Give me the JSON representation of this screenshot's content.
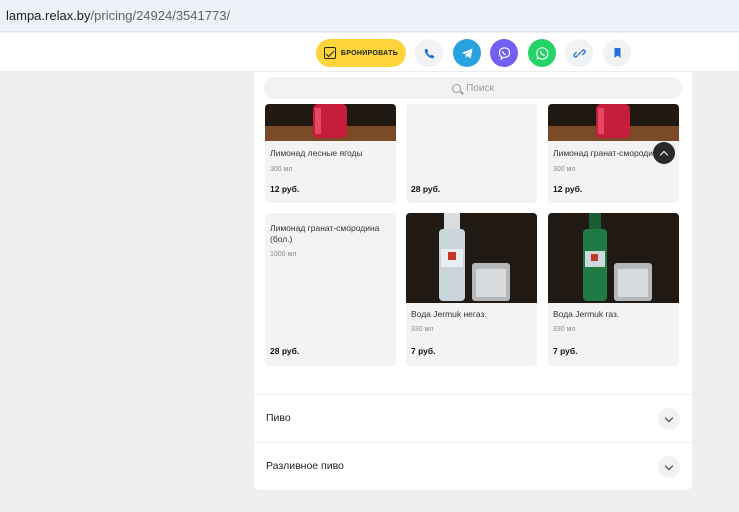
{
  "browser": {
    "url_host": "lampa.relax.by",
    "url_path": "/pricing/24924/3541773/"
  },
  "topbar": {
    "book_label": "БРОНИРОВАТЬ",
    "icons": [
      "calendar-icon",
      "phone-icon",
      "telegram-icon",
      "viber-icon",
      "whatsapp-icon",
      "link-icon",
      "bookmark-icon"
    ],
    "colors": {
      "book": "#ffd43b",
      "telegram": "#29a3e0",
      "viber": "#7360f2",
      "whatsapp": "#25d366"
    }
  },
  "search": {
    "placeholder": "Поиск"
  },
  "products": [
    {
      "name": "Лимонад лесные ягоды",
      "volume": "300 мл",
      "price": "12 руб."
    },
    {
      "name": "",
      "volume": "",
      "price": "28 руб."
    },
    {
      "name": "Лимонад гранат-смородина",
      "volume": "300 мл",
      "price": "12 руб."
    },
    {
      "name": "Лимонад гранат-смородина (бол.)",
      "volume": "1000 мл",
      "price": "28 руб."
    },
    {
      "name": "Вода Jermuk негаз.",
      "volume": "330 мл",
      "price": "7 руб."
    },
    {
      "name": "Вода Jermuk газ.",
      "volume": "330 мл",
      "price": "7 руб."
    }
  ],
  "sections": [
    {
      "title": "Пиво"
    },
    {
      "title": "Разливное пиво"
    }
  ]
}
